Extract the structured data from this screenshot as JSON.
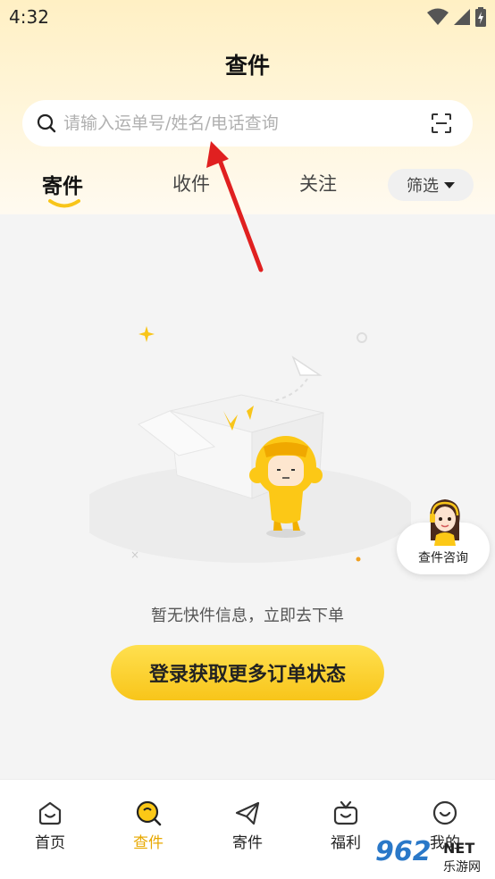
{
  "status_bar": {
    "time": "4:32"
  },
  "page": {
    "title": "查件"
  },
  "search": {
    "placeholder": "请输入运单号/姓名/电话查询"
  },
  "tabs": [
    {
      "label": "寄件",
      "active": true
    },
    {
      "label": "收件",
      "active": false
    },
    {
      "label": "关注",
      "active": false
    }
  ],
  "filter": {
    "label": "筛选"
  },
  "empty_state": {
    "message": "暂无快件信息，立即去下单",
    "button_label": "登录获取更多订单状态"
  },
  "consult": {
    "label": "查件咨询"
  },
  "bottom_nav": [
    {
      "label": "首页",
      "icon": "home-icon",
      "active": false
    },
    {
      "label": "查件",
      "icon": "search-parcel-icon",
      "active": true
    },
    {
      "label": "寄件",
      "icon": "paper-plane-icon",
      "active": false
    },
    {
      "label": "福利",
      "icon": "gift-tv-icon",
      "active": false
    },
    {
      "label": "我的",
      "icon": "smiley-icon",
      "active": false
    }
  ],
  "watermark": {
    "number": "962",
    "net": "NET",
    "site": "乐游网"
  },
  "colors": {
    "accent": "#f8c51a",
    "active_text": "#e8a800",
    "annotation_arrow": "#e02020"
  }
}
